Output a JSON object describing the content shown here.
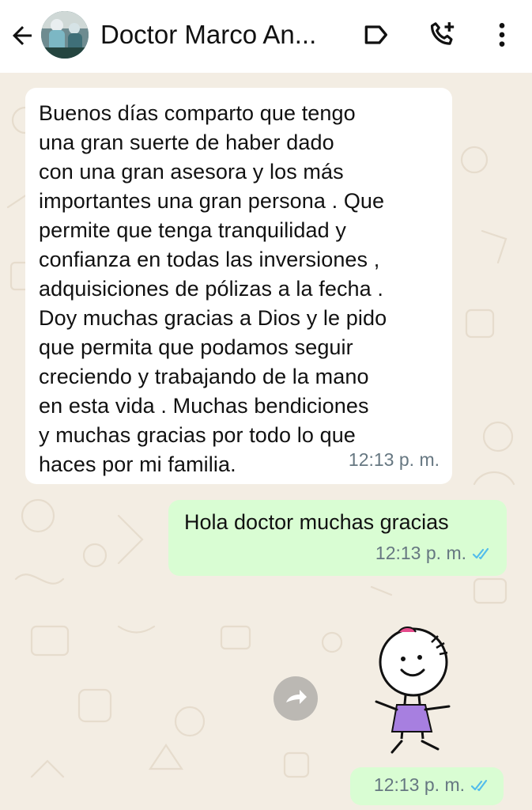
{
  "header": {
    "contact_name": "Doctor Marco An...",
    "icons": [
      "back-arrow-icon",
      "label-icon",
      "add-call-icon",
      "more-vert-icon"
    ]
  },
  "messages": [
    {
      "direction": "incoming",
      "text": "Buenos días comparto que tengo\nuna gran suerte de haber dado\ncon una gran asesora y los más\nimportantes una gran persona . Que\npermite que tenga tranquilidad y\nconfianza en todas las inversiones ,\nadquisiciones de pólizas  a la fecha .\nDoy muchas gracias a Dios y le pido\nque permita que podamos seguir\ncreciendo y trabajando de la mano\nen esta vida  . Muchas bendiciones\ny muchas gracias por todo lo que\nhaces por mi familia.",
      "time": "12:13 p. m."
    },
    {
      "direction": "outgoing",
      "text": "Hola doctor muchas gracias",
      "time": "12:13 p. m.",
      "status": "read"
    },
    {
      "direction": "outgoing",
      "type": "sticker",
      "time": "12:13 p. m.",
      "status": "read"
    }
  ],
  "colors": {
    "wallpaper": "#f3ede3",
    "incoming_bubble": "#ffffff",
    "outgoing_bubble": "#d9fdd3",
    "read_ticks": "#53bdeb",
    "meta_text": "#667781"
  }
}
